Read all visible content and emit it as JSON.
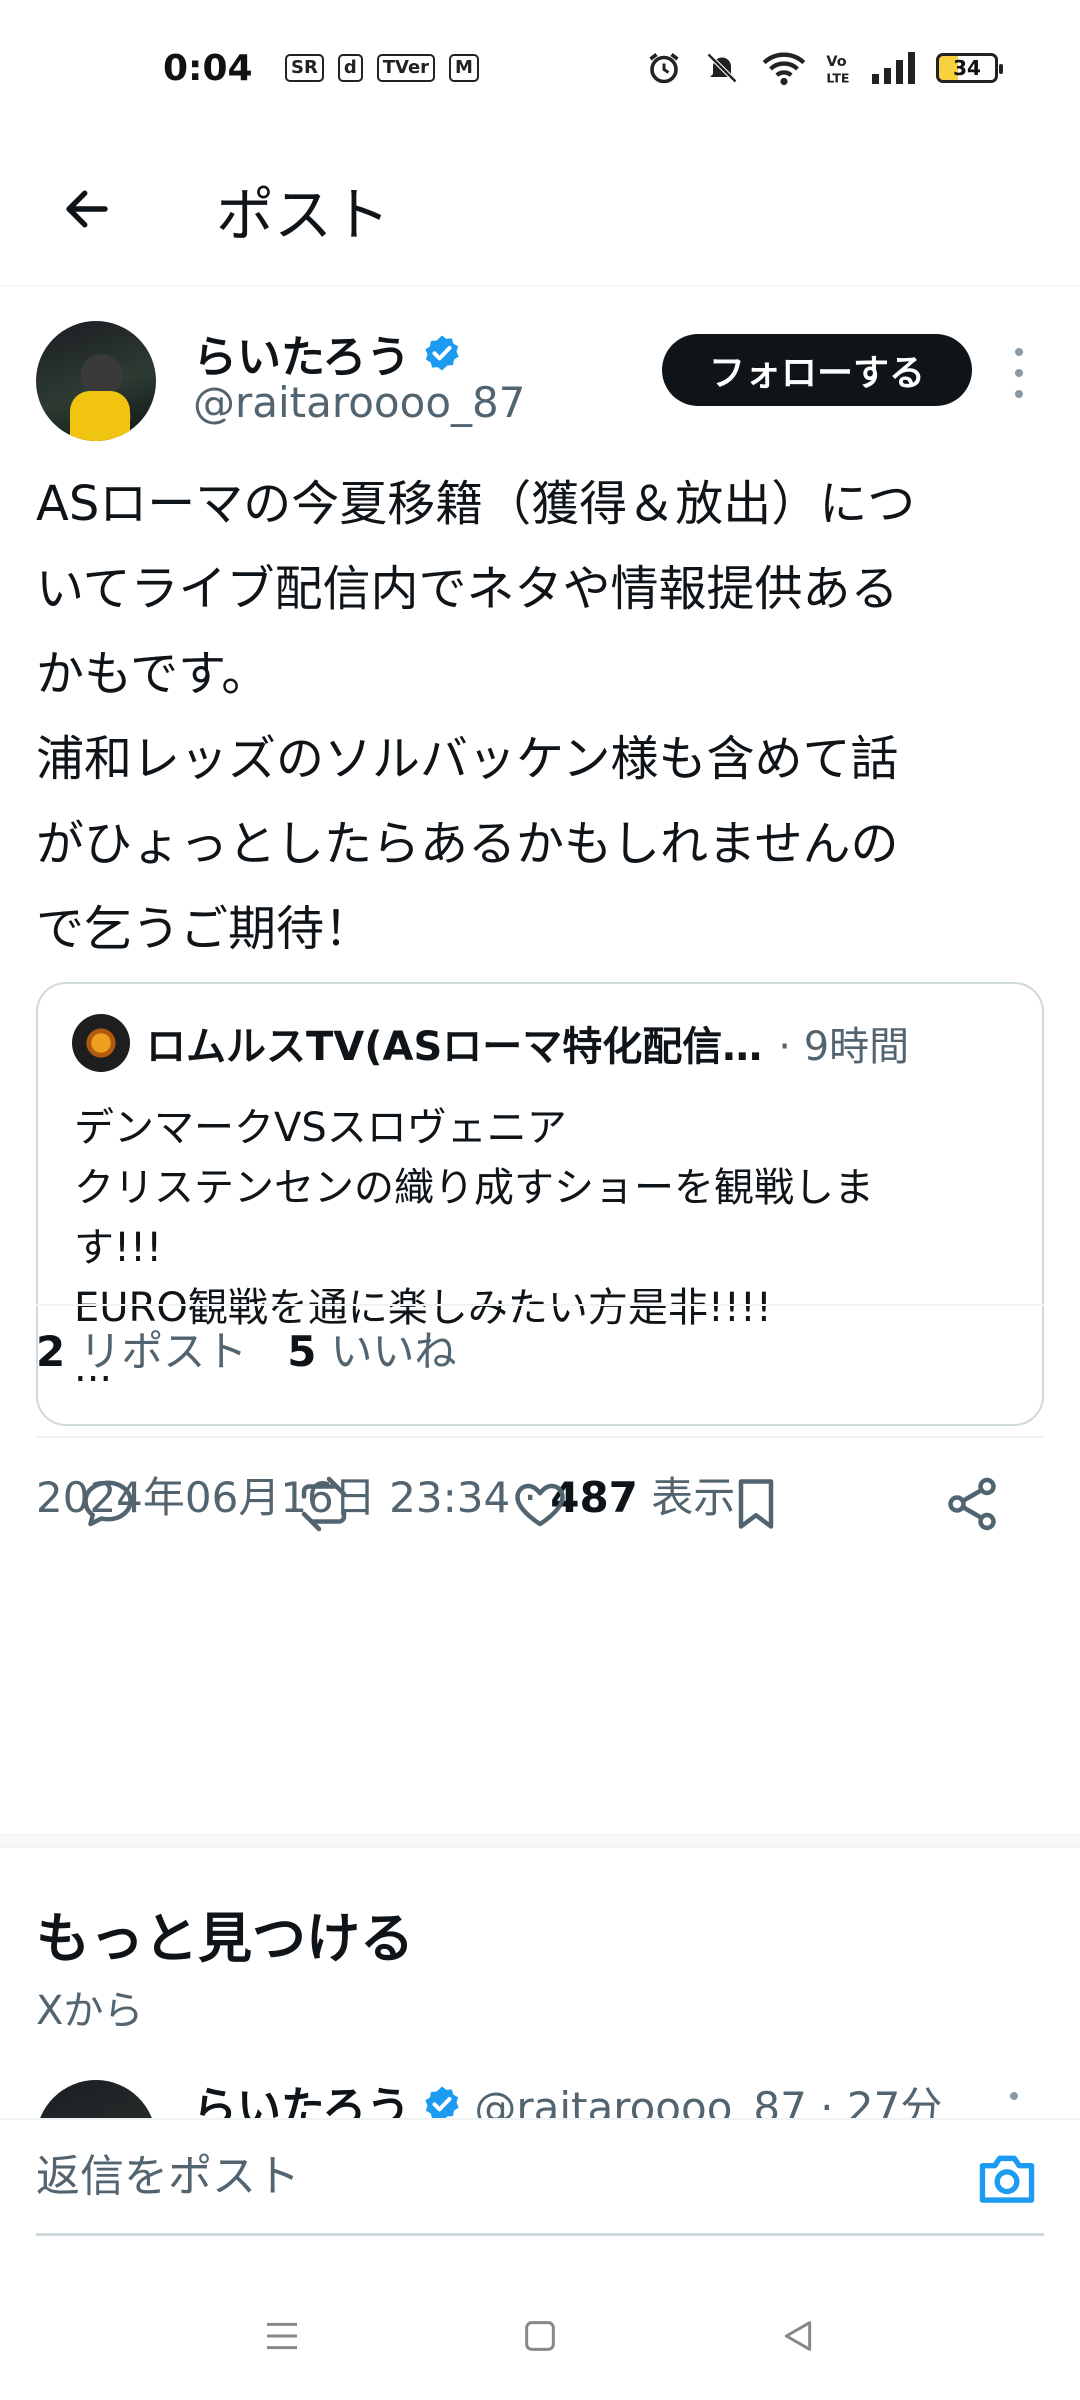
{
  "status_bar": {
    "time": "0:04",
    "apps": [
      "SR",
      "d",
      "TVer",
      "M"
    ],
    "battery": "34"
  },
  "header": {
    "title": "ポスト"
  },
  "tweet": {
    "display_name": "らいたろう",
    "handle": "@raitaroooo_87",
    "follow_label": "フォローする",
    "text": "ASローマの今夏移籍（獲得＆放出）につ\nいてライブ配信内でネタや情報提供ある\nかもです。\n浦和レッズのソルバッケン様も含めて話\nがひょっとしたらあるかもしれませんの\nで乞うご期待！",
    "quote": {
      "name": "ロムルスTV(ASローマ特化配信…",
      "time": "· 9時間",
      "text": "デンマークVSスロヴェニア\nクリステンセンの織り成すショーを観戦しま\nす!!!\nEURO観戦を通に楽しみたい方是非!!!!\n..."
    },
    "timestamp": "2024年06月16日 23:34 · ",
    "views_count": "487",
    "views_label": " 表示",
    "reposts_count": "2",
    "reposts_label": "リポスト",
    "likes_count": "5",
    "likes_label": "いいね"
  },
  "discover": {
    "title": "もっと見つける",
    "subtitle": "Xから",
    "next_name": "らいたろう",
    "next_meta": "@raitaroooo_87 · 27分"
  },
  "reply": {
    "placeholder": "返信をポスト"
  },
  "colors": {
    "verified": "#1d9bf0",
    "accent": "#1d9bf0",
    "text_primary": "#0f1419",
    "text_secondary": "#536471"
  }
}
